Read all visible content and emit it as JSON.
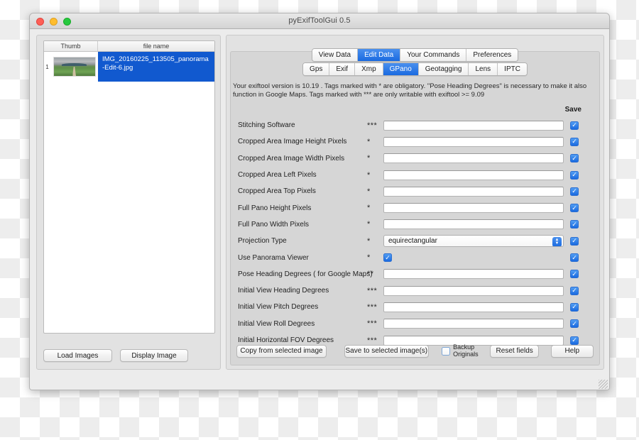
{
  "window": {
    "title": "pyExifToolGui 0.5",
    "traffic_lights": [
      "close",
      "minimize",
      "zoom"
    ]
  },
  "left_panel": {
    "columns": [
      "Thumb",
      "file name"
    ],
    "rows": [
      {
        "index": "1",
        "filename": "IMG_20160225_113505_panorama-Edit-6.jpg",
        "selected": true
      }
    ],
    "buttons": [
      {
        "label": "Load Images"
      },
      {
        "label": "Display Image"
      }
    ]
  },
  "right_panel": {
    "primary_tabs": [
      {
        "label": "View Data",
        "active": false
      },
      {
        "label": "Edit Data",
        "active": true
      },
      {
        "label": "Your Commands",
        "active": false
      },
      {
        "label": "Preferences",
        "active": false
      }
    ],
    "secondary_tabs": [
      {
        "label": "Gps",
        "active": false
      },
      {
        "label": "Exif",
        "active": false
      },
      {
        "label": "Xmp",
        "active": false
      },
      {
        "label": "GPano",
        "active": true
      },
      {
        "label": "Geotagging",
        "active": false
      },
      {
        "label": "Lens",
        "active": false
      },
      {
        "label": "IPTC",
        "active": false
      }
    ],
    "notice": "Your exiftool version is 10.19 . Tags marked with * are obligatory. \"Pose Heading Degrees\" is necessary to make it also function in Google Maps. Tags marked with *** are only writable with exiftool >= 9.09",
    "save_column_header": "Save",
    "fields": [
      {
        "label": "Stitching Software",
        "stars": "***",
        "control": "text",
        "value": "",
        "save": true
      },
      {
        "label": "Cropped Area Image Height Pixels",
        "stars": "*",
        "control": "text",
        "value": "",
        "save": true
      },
      {
        "label": "Cropped Area Image Width Pixels",
        "stars": "*",
        "control": "text",
        "value": "",
        "save": true
      },
      {
        "label": "Cropped Area Left Pixels",
        "stars": "*",
        "control": "text",
        "value": "",
        "save": true
      },
      {
        "label": "Cropped Area Top Pixels",
        "stars": "*",
        "control": "text",
        "value": "",
        "save": true
      },
      {
        "label": "Full Pano Height Pixels",
        "stars": "*",
        "control": "text",
        "value": "",
        "save": true
      },
      {
        "label": "Full Pano Width Pixels",
        "stars": "*",
        "control": "text",
        "value": "",
        "save": true
      },
      {
        "label": "Projection Type",
        "stars": "*",
        "control": "select",
        "value": "equirectangular",
        "save": true
      },
      {
        "label": "Use Panorama Viewer",
        "stars": "*",
        "control": "checkbox",
        "value": true,
        "save": true
      },
      {
        "label": "Pose Heading Degrees ( for Google Maps)",
        "stars": "**",
        "control": "text",
        "value": "",
        "save": true
      },
      {
        "label": "Initial View Heading Degrees",
        "stars": "***",
        "control": "text",
        "value": "",
        "save": true
      },
      {
        "label": "Initial View Pitch Degrees",
        "stars": "***",
        "control": "text",
        "value": "",
        "save": true
      },
      {
        "label": "Initial View Roll Degrees",
        "stars": "***",
        "control": "text",
        "value": "",
        "save": true
      },
      {
        "label": "Initial Horizontal FOV Degrees",
        "stars": "***",
        "control": "text",
        "value": "",
        "save": true
      }
    ],
    "bottom_bar": {
      "copy_button": "Copy from selected image",
      "save_button": "Save to selected image(s)",
      "backup_label": "Backup\nOriginals",
      "backup_checked": false,
      "reset_button": "Reset fields",
      "help_button": "Help"
    }
  },
  "colors": {
    "accent_blue": "#1a6ae0",
    "selection_blue": "#1159cf",
    "window_chrome": "#ececec",
    "panel_gray": "#e2e2e2",
    "card_gray": "#d6d6d6"
  }
}
